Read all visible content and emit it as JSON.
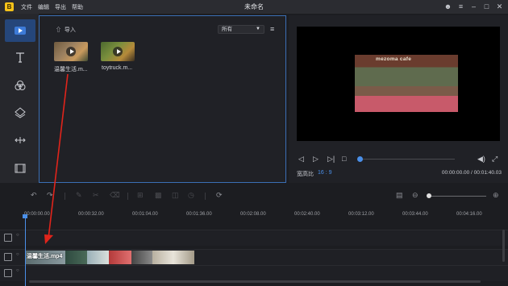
{
  "menu": {
    "file": "文件",
    "edit": "编辑",
    "export": "导出",
    "help": "帮助"
  },
  "window": {
    "title": "未命名",
    "logo_letter": "B"
  },
  "media": {
    "import_label": "导入",
    "filter_value": "所有",
    "items": [
      {
        "name": "温馨生活.m..."
      },
      {
        "name": "toytruck.m..."
      }
    ]
  },
  "preview": {
    "sign_text": "mezoma cafe",
    "aspect_label": "宽高比",
    "aspect_value": "16 : 9",
    "timecode": "00:00:00.00 / 00:01:40.03"
  },
  "timeline": {
    "ruler_labels": [
      "00:00:00.00",
      "00:00:32.00",
      "00:01:04.00",
      "00:01:36.00",
      "00:02:08.00",
      "00:02:40.00",
      "00:03:12.00",
      "00:03:44.00",
      "00:04:16.00"
    ],
    "clip_label": "温馨生活.mp4"
  },
  "colors": {
    "accent": "#4a8fe8",
    "annotation_arrow": "#e0241b",
    "active_tool": "#25467a"
  }
}
